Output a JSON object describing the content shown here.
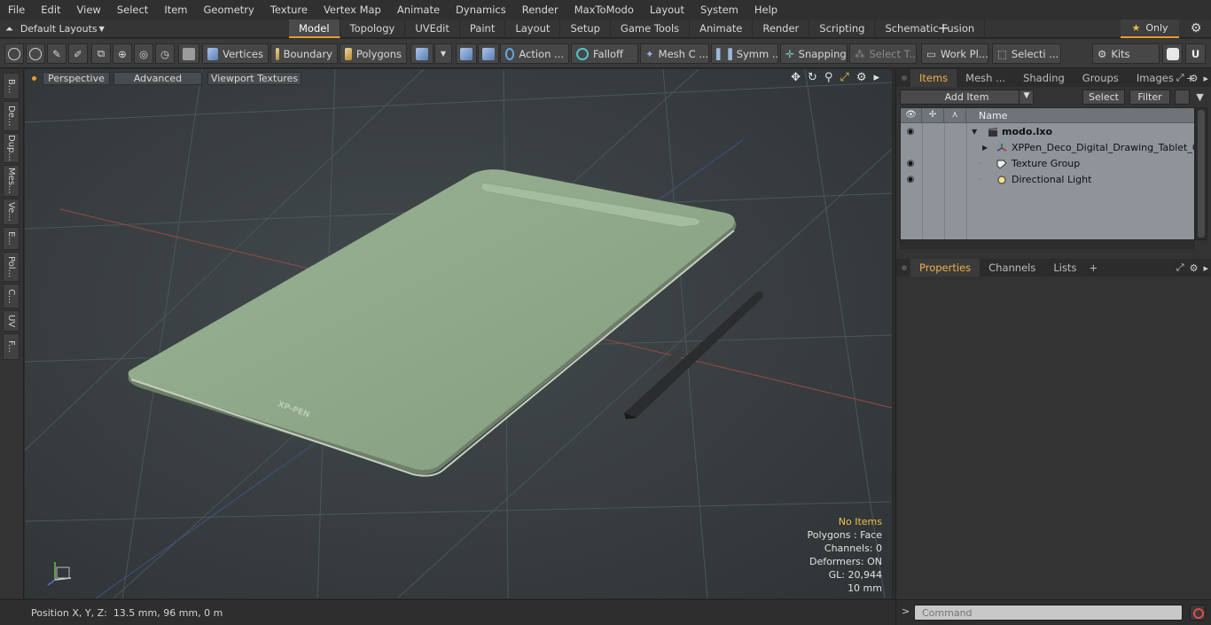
{
  "menu": [
    "File",
    "Edit",
    "View",
    "Select",
    "Item",
    "Geometry",
    "Texture",
    "Vertex Map",
    "Animate",
    "Dynamics",
    "Render",
    "MaxToModo",
    "Layout",
    "System",
    "Help"
  ],
  "layout_selector": "Default Layouts",
  "layout_tabs": [
    "Model",
    "Topology",
    "UVEdit",
    "Paint",
    "Layout",
    "Setup",
    "Game Tools",
    "Animate",
    "Render",
    "Scripting",
    "Schematic Fusion"
  ],
  "active_layout_tab": "Model",
  "only_label": "Only",
  "toolbar": {
    "vertices": "Vertices",
    "boundary": "Boundary",
    "polygons": "Polygons",
    "action": "Action ...",
    "falloff": "Falloff",
    "mesh_c": "Mesh C ...",
    "symm": "Symm ...",
    "snapping": "Snapping",
    "select_t": "Select T...",
    "work_pl": "Work Pl...",
    "selecti": "Selecti ...",
    "kits": "Kits"
  },
  "left_tabs": [
    "B...",
    "De...",
    "Dup...",
    "Mes...",
    "Ve...",
    "E...",
    "Pol...",
    "C...",
    "UV",
    "F..."
  ],
  "viewport": {
    "perspective": "Perspective",
    "advanced": "Advanced",
    "viewport_textures": "Viewport Textures",
    "stats": {
      "no_items": "No Items",
      "polygons": "Polygons : Face",
      "channels": "Channels: 0",
      "deformers": "Deformers: ON",
      "gl": "GL: 20,944",
      "scale": "10 mm"
    },
    "tablet_brand": "XP-PEN"
  },
  "status": {
    "position_label": "Position X, Y, Z:",
    "position_value": "13.5 mm, 96 mm, 0 m"
  },
  "right_panel": {
    "top_tabs": [
      "Items",
      "Mesh ...",
      "Shading",
      "Groups",
      "Images"
    ],
    "active_top_tab": "Items",
    "add_item": "Add Item",
    "select": "Select",
    "filter": "Filter",
    "column_name": "Name",
    "tree": [
      {
        "label": "modo.lxo",
        "bold": true
      },
      {
        "label": "XPPen_Deco_Digital_Drawing_Tablet_Gr..."
      },
      {
        "label": "Texture Group"
      },
      {
        "label": "Directional Light"
      }
    ],
    "bottom_tabs": [
      "Properties",
      "Channels",
      "Lists"
    ],
    "active_bottom_tab": "Properties"
  },
  "command": {
    "placeholder": "Command"
  },
  "colors": {
    "accent": "#e69d2d",
    "viewport_bg": "#383d3f",
    "tablet": "#8fa88a",
    "tree_bg": "#8e9499"
  }
}
